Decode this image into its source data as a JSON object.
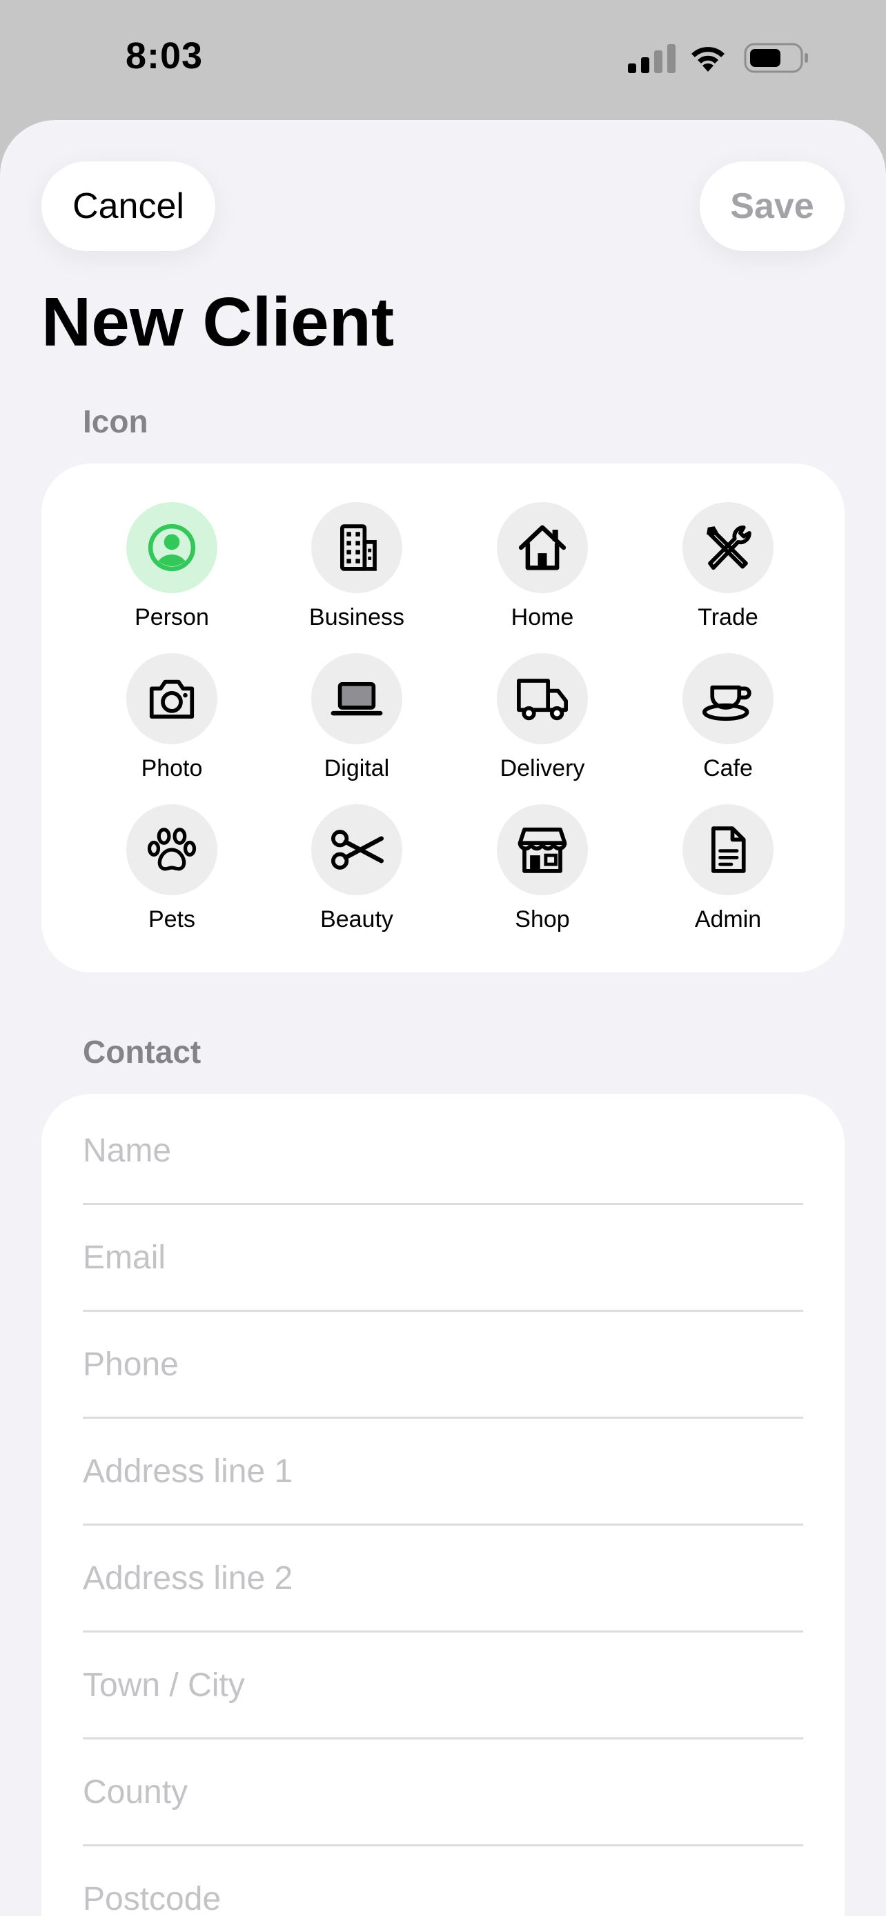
{
  "status_bar": {
    "time": "8:03",
    "icons": [
      "signal-icon",
      "wifi-icon",
      "battery-icon"
    ]
  },
  "header": {
    "cancel_label": "Cancel",
    "save_label": "Save",
    "title": "New Client"
  },
  "icon_section": {
    "label": "Icon",
    "selected": "Person",
    "accent_color": "#34c759",
    "items": [
      {
        "label": "Person",
        "icon": "person-icon"
      },
      {
        "label": "Business",
        "icon": "building-icon"
      },
      {
        "label": "Home",
        "icon": "house-icon"
      },
      {
        "label": "Trade",
        "icon": "tools-icon"
      },
      {
        "label": "Photo",
        "icon": "camera-icon"
      },
      {
        "label": "Digital",
        "icon": "laptop-icon"
      },
      {
        "label": "Delivery",
        "icon": "truck-icon"
      },
      {
        "label": "Cafe",
        "icon": "cup-icon"
      },
      {
        "label": "Pets",
        "icon": "paw-icon"
      },
      {
        "label": "Beauty",
        "icon": "scissors-icon"
      },
      {
        "label": "Shop",
        "icon": "storefront-icon"
      },
      {
        "label": "Admin",
        "icon": "document-icon"
      }
    ]
  },
  "contact_section": {
    "label": "Contact",
    "fields": [
      {
        "placeholder": "Name",
        "value": ""
      },
      {
        "placeholder": "Email",
        "value": ""
      },
      {
        "placeholder": "Phone",
        "value": ""
      },
      {
        "placeholder": "Address line 1",
        "value": ""
      },
      {
        "placeholder": "Address line 2",
        "value": ""
      },
      {
        "placeholder": "Town / City",
        "value": ""
      },
      {
        "placeholder": "County",
        "value": ""
      },
      {
        "placeholder": "Postcode",
        "value": ""
      }
    ]
  }
}
